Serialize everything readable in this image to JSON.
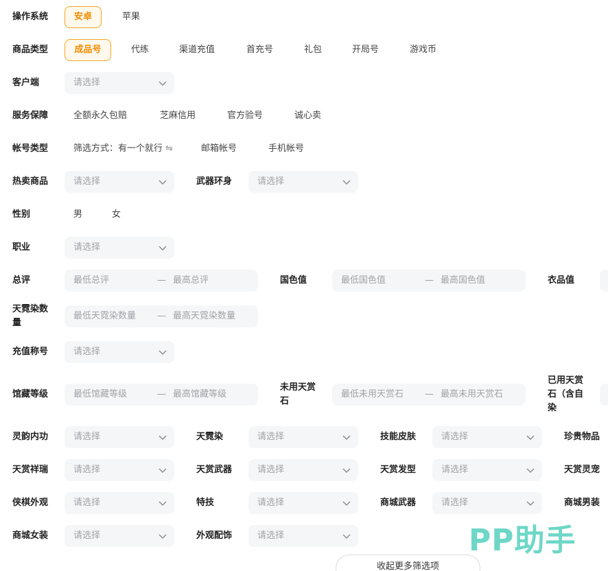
{
  "filters": {
    "os": {
      "label": "操作系统",
      "options": [
        "安卓",
        "苹果"
      ],
      "selected": "安卓"
    },
    "product_type": {
      "label": "商品类型",
      "options": [
        "成品号",
        "代练",
        "渠道充值",
        "首充号",
        "礼包",
        "开局号",
        "游戏币"
      ],
      "selected": "成品号"
    },
    "client": {
      "label": "客户端",
      "placeholder": "请选择"
    },
    "service": {
      "label": "服务保障",
      "options": [
        "全额永久包赔",
        "芝麻信用",
        "官方验号",
        "诚心卖"
      ]
    },
    "account_type": {
      "label": "帐号类型",
      "mode": "筛选方式：有一个就行",
      "swap_icon": "⇋",
      "options": [
        "邮箱帐号",
        "手机帐号"
      ]
    },
    "hot": {
      "label": "热卖商品",
      "placeholder": "请选择"
    },
    "weapon": {
      "label": "武器环身",
      "placeholder": "请选择"
    },
    "gender": {
      "label": "性别",
      "options": [
        "男",
        "女"
      ]
    },
    "job": {
      "label": "职业",
      "placeholder": "请选择"
    },
    "score": {
      "label": "总评",
      "min": "最低总评",
      "max": "最高总评",
      "dash": "—"
    },
    "guose": {
      "label": "国色值",
      "min": "最低国色值",
      "max": "最高国色值",
      "dash": "—"
    },
    "clothes": {
      "label": "衣品值"
    },
    "tianni": {
      "label": "天霓染数量",
      "min": "最低天霓染数量",
      "max": "最高天霓染数量",
      "dash": "—"
    },
    "recharge_title": {
      "label": "充值称号",
      "placeholder": "请选择"
    },
    "collection": {
      "label": "馆藏等级",
      "min": "最低馆藏等级",
      "max": "最高馆藏等级",
      "dash": "—"
    },
    "unused_stone": {
      "label": "未用天赏石",
      "min": "最低未用天赏石",
      "max": "最高未用天赏石",
      "dash": "—"
    },
    "used_stone": {
      "label": "已用天赏石（含自染"
    },
    "grid": [
      [
        {
          "label": "灵韵内功",
          "placeholder": "请选择"
        },
        {
          "label": "天霓染",
          "placeholder": "请选择"
        },
        {
          "label": "技能皮肤",
          "placeholder": "请选择"
        },
        {
          "label": "珍贵物品"
        }
      ],
      [
        {
          "label": "天赏祥瑞",
          "placeholder": "请选择"
        },
        {
          "label": "天赏武器",
          "placeholder": "请选择"
        },
        {
          "label": "天赏发型",
          "placeholder": "请选择"
        },
        {
          "label": "天赏灵宠"
        }
      ],
      [
        {
          "label": "侠棋外观",
          "placeholder": "请选择"
        },
        {
          "label": "特技",
          "placeholder": "请选择"
        },
        {
          "label": "商城武器",
          "placeholder": "请选择"
        },
        {
          "label": "商城男装"
        }
      ],
      [
        {
          "label": "商城女装",
          "placeholder": "请选择"
        },
        {
          "label": "外观配饰",
          "placeholder": "请选择"
        }
      ]
    ]
  },
  "collapse_label": "收起更多筛选项",
  "watermark": "PP助手",
  "colors": {
    "accent": "#f5a623",
    "accent_text": "#f08c00",
    "field_bg": "#f5f6f7",
    "watermark": "#5fd3c1"
  }
}
